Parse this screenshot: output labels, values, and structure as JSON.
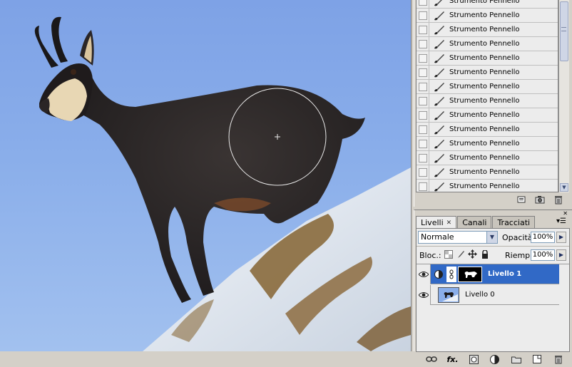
{
  "history": {
    "step_label": "Strumento Pennello",
    "visible_steps": 14
  },
  "layers_panel": {
    "tabs": [
      {
        "label": "Livelli",
        "active": true
      },
      {
        "label": "Canali",
        "active": false
      },
      {
        "label": "Tracciati",
        "active": false
      }
    ],
    "blend_mode": "Normale",
    "opacity_label": "Opacità:",
    "opacity_value": "100%",
    "lock_label": "Bloc.:",
    "fill_label": "Riemp.:",
    "fill_value": "100%",
    "layers": [
      {
        "name": "Livello 1",
        "selected": true,
        "has_mask": true
      },
      {
        "name": "Livello 0",
        "selected": false,
        "has_mask": false
      }
    ]
  },
  "colors": {
    "sky": "#8aaeea",
    "selection": "#3169c6",
    "panel": "#d4d0c8"
  },
  "icons": {
    "history_footer": [
      "new-document-icon",
      "snapshot-camera-icon",
      "trash-icon"
    ],
    "layers_footer": [
      "link-layers-icon",
      "layer-style-fx-icon",
      "add-mask-icon",
      "adjustment-layer-icon",
      "new-group-folder-icon",
      "new-layer-icon",
      "trash-icon"
    ]
  }
}
